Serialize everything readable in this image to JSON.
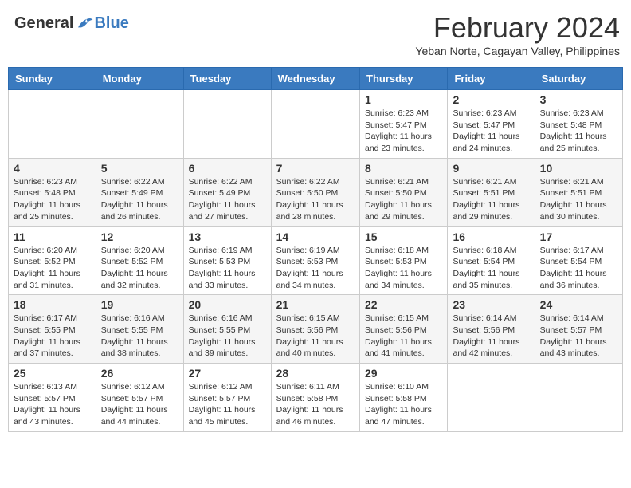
{
  "logo": {
    "general": "General",
    "blue": "Blue"
  },
  "title": "February 2024",
  "subtitle": "Yeban Norte, Cagayan Valley, Philippines",
  "days_of_week": [
    "Sunday",
    "Monday",
    "Tuesday",
    "Wednesday",
    "Thursday",
    "Friday",
    "Saturday"
  ],
  "weeks": [
    [
      {
        "day": "",
        "info": ""
      },
      {
        "day": "",
        "info": ""
      },
      {
        "day": "",
        "info": ""
      },
      {
        "day": "",
        "info": ""
      },
      {
        "day": "1",
        "info": "Sunrise: 6:23 AM\nSunset: 5:47 PM\nDaylight: 11 hours and 23 minutes."
      },
      {
        "day": "2",
        "info": "Sunrise: 6:23 AM\nSunset: 5:47 PM\nDaylight: 11 hours and 24 minutes."
      },
      {
        "day": "3",
        "info": "Sunrise: 6:23 AM\nSunset: 5:48 PM\nDaylight: 11 hours and 25 minutes."
      }
    ],
    [
      {
        "day": "4",
        "info": "Sunrise: 6:23 AM\nSunset: 5:48 PM\nDaylight: 11 hours and 25 minutes."
      },
      {
        "day": "5",
        "info": "Sunrise: 6:22 AM\nSunset: 5:49 PM\nDaylight: 11 hours and 26 minutes."
      },
      {
        "day": "6",
        "info": "Sunrise: 6:22 AM\nSunset: 5:49 PM\nDaylight: 11 hours and 27 minutes."
      },
      {
        "day": "7",
        "info": "Sunrise: 6:22 AM\nSunset: 5:50 PM\nDaylight: 11 hours and 28 minutes."
      },
      {
        "day": "8",
        "info": "Sunrise: 6:21 AM\nSunset: 5:50 PM\nDaylight: 11 hours and 29 minutes."
      },
      {
        "day": "9",
        "info": "Sunrise: 6:21 AM\nSunset: 5:51 PM\nDaylight: 11 hours and 29 minutes."
      },
      {
        "day": "10",
        "info": "Sunrise: 6:21 AM\nSunset: 5:51 PM\nDaylight: 11 hours and 30 minutes."
      }
    ],
    [
      {
        "day": "11",
        "info": "Sunrise: 6:20 AM\nSunset: 5:52 PM\nDaylight: 11 hours and 31 minutes."
      },
      {
        "day": "12",
        "info": "Sunrise: 6:20 AM\nSunset: 5:52 PM\nDaylight: 11 hours and 32 minutes."
      },
      {
        "day": "13",
        "info": "Sunrise: 6:19 AM\nSunset: 5:53 PM\nDaylight: 11 hours and 33 minutes."
      },
      {
        "day": "14",
        "info": "Sunrise: 6:19 AM\nSunset: 5:53 PM\nDaylight: 11 hours and 34 minutes."
      },
      {
        "day": "15",
        "info": "Sunrise: 6:18 AM\nSunset: 5:53 PM\nDaylight: 11 hours and 34 minutes."
      },
      {
        "day": "16",
        "info": "Sunrise: 6:18 AM\nSunset: 5:54 PM\nDaylight: 11 hours and 35 minutes."
      },
      {
        "day": "17",
        "info": "Sunrise: 6:17 AM\nSunset: 5:54 PM\nDaylight: 11 hours and 36 minutes."
      }
    ],
    [
      {
        "day": "18",
        "info": "Sunrise: 6:17 AM\nSunset: 5:55 PM\nDaylight: 11 hours and 37 minutes."
      },
      {
        "day": "19",
        "info": "Sunrise: 6:16 AM\nSunset: 5:55 PM\nDaylight: 11 hours and 38 minutes."
      },
      {
        "day": "20",
        "info": "Sunrise: 6:16 AM\nSunset: 5:55 PM\nDaylight: 11 hours and 39 minutes."
      },
      {
        "day": "21",
        "info": "Sunrise: 6:15 AM\nSunset: 5:56 PM\nDaylight: 11 hours and 40 minutes."
      },
      {
        "day": "22",
        "info": "Sunrise: 6:15 AM\nSunset: 5:56 PM\nDaylight: 11 hours and 41 minutes."
      },
      {
        "day": "23",
        "info": "Sunrise: 6:14 AM\nSunset: 5:56 PM\nDaylight: 11 hours and 42 minutes."
      },
      {
        "day": "24",
        "info": "Sunrise: 6:14 AM\nSunset: 5:57 PM\nDaylight: 11 hours and 43 minutes."
      }
    ],
    [
      {
        "day": "25",
        "info": "Sunrise: 6:13 AM\nSunset: 5:57 PM\nDaylight: 11 hours and 43 minutes."
      },
      {
        "day": "26",
        "info": "Sunrise: 6:12 AM\nSunset: 5:57 PM\nDaylight: 11 hours and 44 minutes."
      },
      {
        "day": "27",
        "info": "Sunrise: 6:12 AM\nSunset: 5:57 PM\nDaylight: 11 hours and 45 minutes."
      },
      {
        "day": "28",
        "info": "Sunrise: 6:11 AM\nSunset: 5:58 PM\nDaylight: 11 hours and 46 minutes."
      },
      {
        "day": "29",
        "info": "Sunrise: 6:10 AM\nSunset: 5:58 PM\nDaylight: 11 hours and 47 minutes."
      },
      {
        "day": "",
        "info": ""
      },
      {
        "day": "",
        "info": ""
      }
    ]
  ]
}
